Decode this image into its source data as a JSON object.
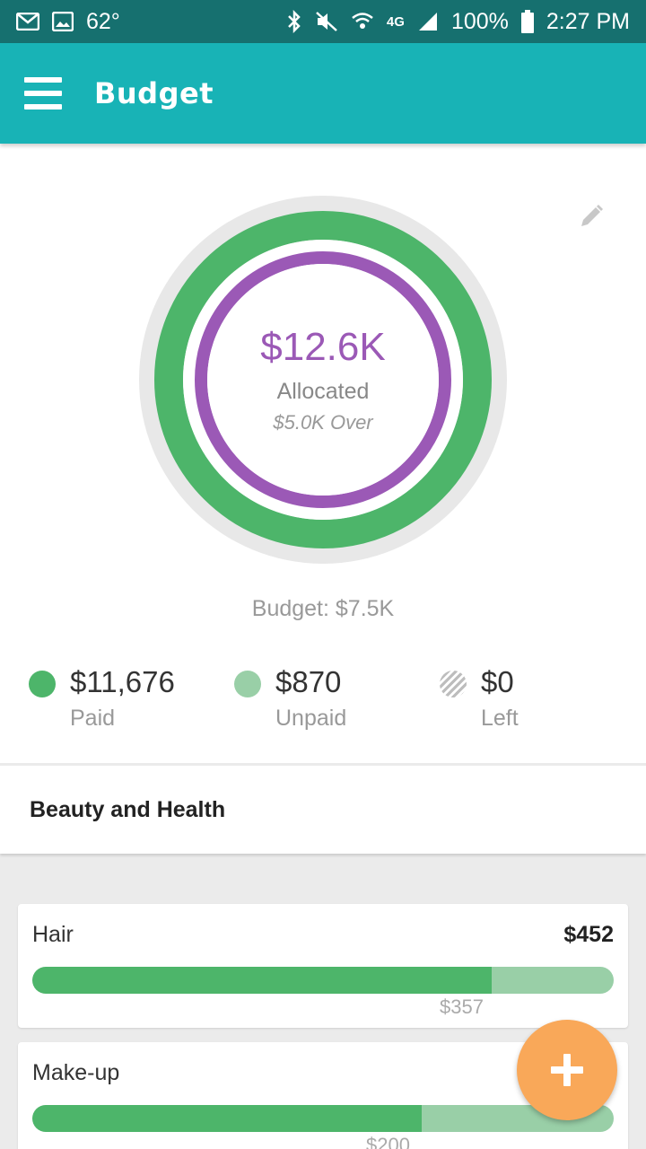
{
  "status_bar": {
    "temperature": "62°",
    "network": "4G",
    "battery": "100%",
    "time": "2:27 PM",
    "icons": [
      "mail-icon",
      "image-icon",
      "bluetooth-icon",
      "mute-icon",
      "wifi-icon",
      "signal-icon",
      "battery-icon"
    ]
  },
  "app_bar": {
    "title": "Budget",
    "color": "#18b3b6"
  },
  "summary": {
    "allocated_amount": "$12.6K",
    "allocated_label": "Allocated",
    "over_text": "$5.0K Over",
    "budget_text": "Budget: $7.5K",
    "ring_colors": {
      "outer": "#4db56a",
      "inner": "#9b59b6",
      "track": "#e8e8e8"
    },
    "legend": [
      {
        "value": "$11,676",
        "label": "Paid",
        "color": "#4db56a"
      },
      {
        "value": "$870",
        "label": "Unpaid",
        "color": "#99cfa7"
      },
      {
        "value": "$0",
        "label": "Left",
        "color": "#bbbbbb"
      }
    ]
  },
  "category": {
    "title": "Beauty and Health"
  },
  "items": [
    {
      "name": "Hair",
      "amount": "$452",
      "paid_fraction": 0.79,
      "bar_label": "$357"
    },
    {
      "name": "Make-up",
      "amount": "",
      "paid_fraction": 0.67,
      "bar_label": "$200"
    }
  ],
  "fab": {
    "icon": "plus-icon",
    "color": "#f9a859"
  }
}
